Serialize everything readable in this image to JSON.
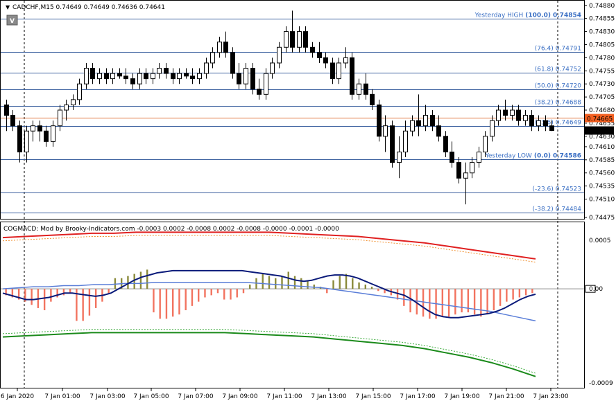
{
  "header": {
    "title": "CADCHF,M15  0.74649 0.74649 0.74636 0.74641",
    "button_glyph": "V"
  },
  "indicator": {
    "title": "COGMACD: Mod by Brooky-Indicators.com -0.0003 0.0002 -0.0008 0.0002 -0.0008 -0.0000 -0.0001 -0.0000"
  },
  "colors": {
    "bull": "#ffffff",
    "bear": "#000000",
    "level_line": "#3a5f9e",
    "level_text": "#3a6fc4",
    "current_line": "#e0733a",
    "current_tag": "#f25f20",
    "hist_pos": "#8a8a3a",
    "hist_neg": "#f2735f",
    "macd_line": "#0a1a7a",
    "signal_line": "#5a7ed8",
    "upper_band": "#e02020",
    "upper_band_dash": "#f09030",
    "lower_band": "#1a8a1a",
    "lower_band_dash": "#3aaa3a"
  },
  "chart_data": [
    {
      "type": "candlestick",
      "name": "CADCHF,M15",
      "ylim": [
        0.74475,
        0.74885
      ],
      "y_ticks": [
        "0.74880",
        "0.74855",
        "0.74830",
        "0.74805",
        "0.74780",
        "0.74755",
        "0.74730",
        "0.74705",
        "0.74680",
        "0.74655",
        "0.74630",
        "0.74610",
        "0.74585",
        "0.74560",
        "0.74535",
        "0.74510",
        "0.74475"
      ],
      "x_ticks": [
        "6 Jan 2020",
        "7 Jan 01:00",
        "7 Jan 03:00",
        "7 Jan 05:00",
        "7 Jan 07:00",
        "7 Jan 09:00",
        "7 Jan 11:00",
        "7 Jan 13:00",
        "7 Jan 15:00",
        "7 Jan 17:00",
        "7 Jan 19:00",
        "7 Jan 21:00",
        "7 Jan 23:00"
      ],
      "ohlc": [
        [
          0.7469,
          0.747,
          0.7464,
          0.7467
        ],
        [
          0.7467,
          0.7468,
          0.7464,
          0.7465
        ],
        [
          0.7465,
          0.7466,
          0.7458,
          0.746
        ],
        [
          0.746,
          0.7465,
          0.7458,
          0.7464
        ],
        [
          0.7464,
          0.7466,
          0.7462,
          0.7465
        ],
        [
          0.7465,
          0.7466,
          0.7462,
          0.7464
        ],
        [
          0.7464,
          0.7465,
          0.7461,
          0.7462
        ],
        [
          0.7462,
          0.7466,
          0.7461,
          0.7465
        ],
        [
          0.7465,
          0.7469,
          0.7464,
          0.7468
        ],
        [
          0.7468,
          0.747,
          0.7466,
          0.7469
        ],
        [
          0.7469,
          0.7471,
          0.7468,
          0.747
        ],
        [
          0.747,
          0.7474,
          0.7469,
          0.7473
        ],
        [
          0.7473,
          0.7477,
          0.7472,
          0.7476
        ],
        [
          0.7476,
          0.7477,
          0.7473,
          0.7474
        ],
        [
          0.7474,
          0.7476,
          0.7473,
          0.7475
        ],
        [
          0.7475,
          0.7476,
          0.7473,
          0.7474
        ],
        [
          0.7474,
          0.7476,
          0.7473,
          0.7475
        ],
        [
          0.7475,
          0.7476,
          0.7474,
          0.74745
        ],
        [
          0.74745,
          0.7476,
          0.7473,
          0.7474
        ],
        [
          0.7474,
          0.7475,
          0.7472,
          0.7473
        ],
        [
          0.7473,
          0.7476,
          0.7472,
          0.7475
        ],
        [
          0.7475,
          0.7476,
          0.7473,
          0.7474
        ],
        [
          0.7474,
          0.7476,
          0.7473,
          0.7475
        ],
        [
          0.7475,
          0.7477,
          0.7474,
          0.7476
        ],
        [
          0.7476,
          0.7477,
          0.7474,
          0.7475
        ],
        [
          0.7475,
          0.7476,
          0.7473,
          0.7474
        ],
        [
          0.7474,
          0.7476,
          0.7473,
          0.7475
        ],
        [
          0.7475,
          0.7476,
          0.7474,
          0.74745
        ],
        [
          0.74745,
          0.7476,
          0.7473,
          0.7474
        ],
        [
          0.7474,
          0.7476,
          0.7473,
          0.7475
        ],
        [
          0.7475,
          0.7478,
          0.7474,
          0.7477
        ],
        [
          0.7477,
          0.748,
          0.7476,
          0.7479
        ],
        [
          0.7479,
          0.7482,
          0.7478,
          0.7481
        ],
        [
          0.7481,
          0.7483,
          0.7478,
          0.7479
        ],
        [
          0.7479,
          0.748,
          0.7474,
          0.7475
        ],
        [
          0.7475,
          0.7477,
          0.7472,
          0.7473
        ],
        [
          0.7473,
          0.7477,
          0.7472,
          0.7476
        ],
        [
          0.7476,
          0.7477,
          0.7471,
          0.7472
        ],
        [
          0.7472,
          0.7474,
          0.747,
          0.7471
        ],
        [
          0.7471,
          0.7476,
          0.747,
          0.7475
        ],
        [
          0.7475,
          0.7478,
          0.7474,
          0.7477
        ],
        [
          0.7477,
          0.7481,
          0.7476,
          0.748
        ],
        [
          0.748,
          0.7484,
          0.7479,
          0.7483
        ],
        [
          0.7483,
          0.7487,
          0.7479,
          0.748
        ],
        [
          0.748,
          0.7484,
          0.7479,
          0.7483
        ],
        [
          0.7483,
          0.7484,
          0.7479,
          0.748
        ],
        [
          0.748,
          0.7481,
          0.7478,
          0.7479
        ],
        [
          0.7479,
          0.7481,
          0.7477,
          0.7478
        ],
        [
          0.7478,
          0.7479,
          0.7476,
          0.7477
        ],
        [
          0.7477,
          0.7478,
          0.7473,
          0.7474
        ],
        [
          0.7474,
          0.7478,
          0.7473,
          0.7477
        ],
        [
          0.7477,
          0.748,
          0.7476,
          0.7478
        ],
        [
          0.7478,
          0.7479,
          0.747,
          0.7471
        ],
        [
          0.7471,
          0.7474,
          0.747,
          0.7473
        ],
        [
          0.7473,
          0.7475,
          0.747,
          0.7471
        ],
        [
          0.7471,
          0.7472,
          0.7468,
          0.7469
        ],
        [
          0.7469,
          0.747,
          0.7462,
          0.7463
        ],
        [
          0.7463,
          0.7467,
          0.746,
          0.7465
        ],
        [
          0.7465,
          0.7466,
          0.7457,
          0.7458
        ],
        [
          0.7458,
          0.7463,
          0.7455,
          0.746
        ],
        [
          0.746,
          0.7466,
          0.7459,
          0.7464
        ],
        [
          0.7464,
          0.7467,
          0.7463,
          0.7466
        ],
        [
          0.7466,
          0.7471,
          0.7463,
          0.7465
        ],
        [
          0.7465,
          0.7469,
          0.7464,
          0.7467
        ],
        [
          0.7467,
          0.7468,
          0.7464,
          0.7465
        ],
        [
          0.7465,
          0.7467,
          0.7462,
          0.7463
        ],
        [
          0.7463,
          0.7464,
          0.7459,
          0.746
        ],
        [
          0.746,
          0.7462,
          0.7457,
          0.7458
        ],
        [
          0.7458,
          0.7459,
          0.7454,
          0.7455
        ],
        [
          0.7455,
          0.7458,
          0.745,
          0.7456
        ],
        [
          0.7456,
          0.7459,
          0.7455,
          0.7458
        ],
        [
          0.7458,
          0.7461,
          0.7457,
          0.746
        ],
        [
          0.746,
          0.7464,
          0.7459,
          0.7463
        ],
        [
          0.7463,
          0.7467,
          0.7462,
          0.7466
        ],
        [
          0.7466,
          0.7469,
          0.7465,
          0.7468
        ],
        [
          0.7468,
          0.747,
          0.7466,
          0.7467
        ],
        [
          0.7467,
          0.7469,
          0.7466,
          0.7468
        ],
        [
          0.7468,
          0.7469,
          0.7465,
          0.7466
        ],
        [
          0.7466,
          0.7468,
          0.7465,
          0.7467
        ],
        [
          0.7467,
          0.7468,
          0.7464,
          0.7465
        ],
        [
          0.7465,
          0.7467,
          0.7464,
          0.7466
        ],
        [
          0.7466,
          0.7467,
          0.7464,
          0.7465
        ],
        [
          0.7465,
          0.7466,
          0.7464,
          0.74641
        ]
      ],
      "levels": [
        {
          "label": "Yesterday HIGH",
          "pct": "(100.0)",
          "value": "0.74854"
        },
        {
          "label": "",
          "pct": "(76.4)",
          "value": "0.74791"
        },
        {
          "label": "",
          "pct": "(61.8)",
          "value": "0.74752"
        },
        {
          "label": "",
          "pct": "(50.0)",
          "value": "0.74720"
        },
        {
          "label": "",
          "pct": "(38.2)",
          "value": "0.74688"
        },
        {
          "label": "",
          "pct": "(23.6)",
          "value": "0.74649"
        },
        {
          "label": "Yesterday LOW",
          "pct": "(0.0)",
          "value": "0.74586"
        },
        {
          "label": "",
          "pct": "(-23.6)",
          "value": "0.74523"
        },
        {
          "label": "",
          "pct": "(-38.2)",
          "value": "0.74484"
        }
      ],
      "current_line": "0.74665",
      "bid_tag": "0.74641"
    },
    {
      "type": "histogram+lines",
      "name": "COGMACD",
      "ylim": [
        -0.0009,
        0.0005
      ],
      "y_ticks": [
        "0.0005",
        "0.00",
        "-0.0009"
      ],
      "histogram": [
        -6e-05,
        -8e-05,
        -0.0001,
        -0.00012,
        -0.00015,
        -0.00018,
        -0.0002,
        -0.00012,
        -8e-05,
        -6e-05,
        -4e-05,
        -0.0003,
        -0.0003,
        -0.00025,
        -0.00018,
        -0.00012,
        -4e-05,
        0.0001,
        0.0001,
        0.00012,
        0.00014,
        0.00016,
        0.00018,
        -0.00022,
        -0.00028,
        -0.00028,
        -0.00026,
        -0.00024,
        -0.0002,
        -0.00016,
        -0.00012,
        -8e-05,
        -6e-05,
        -4e-05,
        -0.0001,
        -0.0001,
        -8e-05,
        -4e-05,
        4e-05,
        0.0001,
        0.00014,
        0.00012,
        0.0001,
        0.00012,
        0.00016,
        0.00012,
        0.0001,
        8e-05,
        4e-05,
        2e-05,
        -4e-05,
        8e-05,
        0.00012,
        0.00014,
        0.0001,
        6e-05,
        4e-05,
        2e-05,
        -2e-05,
        -4e-05,
        -6e-05,
        -0.0001,
        -0.00016,
        -0.00022,
        -0.00024,
        -0.00026,
        -0.00028,
        -0.00028,
        -0.00026,
        -0.00026,
        -0.00024,
        -0.00022,
        -0.00022,
        -0.00024,
        -0.00026,
        -0.00024,
        -0.0002,
        -0.00016,
        -0.00012,
        -0.0001,
        -8e-05,
        -6e-05,
        -4e-05
      ],
      "macd": [
        -4e-05,
        -6e-05,
        -8e-05,
        -0.0001,
        -0.0001,
        -9e-05,
        -8e-05,
        -6e-05,
        -4e-05,
        -4e-05,
        -5e-05,
        -6e-05,
        -7e-05,
        -6e-05,
        -4e-05,
        0.0,
        4e-05,
        8e-05,
        0.00011,
        0.00013,
        0.00015,
        0.00016,
        0.00017,
        0.00017,
        0.00017,
        0.00017,
        0.00017,
        0.00017,
        0.00017,
        0.00017,
        0.00017,
        0.00017,
        0.00016,
        0.00015,
        0.00014,
        0.00013,
        0.00012,
        0.0001,
        8e-05,
        7e-05,
        8e-05,
        0.0001,
        0.00012,
        0.00013,
        0.00013,
        0.00012,
        0.0001,
        7e-05,
        4e-05,
        1e-05,
        -2e-05,
        -4e-05,
        -6e-05,
        -0.0001,
        -0.00015,
        -0.0002,
        -0.00024,
        -0.00026,
        -0.00027,
        -0.00027,
        -0.00026,
        -0.00025,
        -0.00024,
        -0.00023,
        -0.00021,
        -0.00018,
        -0.00014,
        -0.0001,
        -7e-05,
        -5e-05
      ],
      "signal": [
        0.0,
        1e-05,
        2e-05,
        2e-05,
        3e-05,
        3e-05,
        4e-05,
        4e-05,
        5e-05,
        5e-05,
        6e-05,
        6e-05,
        6e-05,
        6e-05,
        6e-05,
        6e-05,
        6e-05,
        5e-05,
        4e-05,
        3e-05,
        2e-05,
        1e-05,
        -1e-05,
        -3e-05,
        -5e-05,
        -7e-05,
        -9e-05,
        -0.00011,
        -0.00013,
        -0.00015,
        -0.00017,
        -0.00019,
        -0.00021,
        -0.00024,
        -0.00027,
        -0.0003
      ],
      "upper_band": [
        0.00048,
        0.00049,
        0.0005,
        0.00051,
        0.00052,
        0.00052,
        0.00053,
        0.00053,
        0.00053,
        0.00053,
        0.00053,
        0.00053,
        0.00053,
        0.00052,
        0.00051,
        0.0005,
        0.00049,
        0.00047,
        0.00045,
        0.00043,
        0.0004,
        0.00037,
        0.00034,
        0.00031,
        0.00028
      ],
      "lower_band": [
        -0.00045,
        -0.00044,
        -0.00043,
        -0.00042,
        -0.00041,
        -0.00041,
        -0.00041,
        -0.00041,
        -0.00041,
        -0.00041,
        -0.00041,
        -0.00042,
        -0.00043,
        -0.00044,
        -0.00045,
        -0.00047,
        -0.00049,
        -0.00051,
        -0.00053,
        -0.00056,
        -0.0006,
        -0.00064,
        -0.00069,
        -0.00075,
        -0.00082
      ]
    }
  ]
}
